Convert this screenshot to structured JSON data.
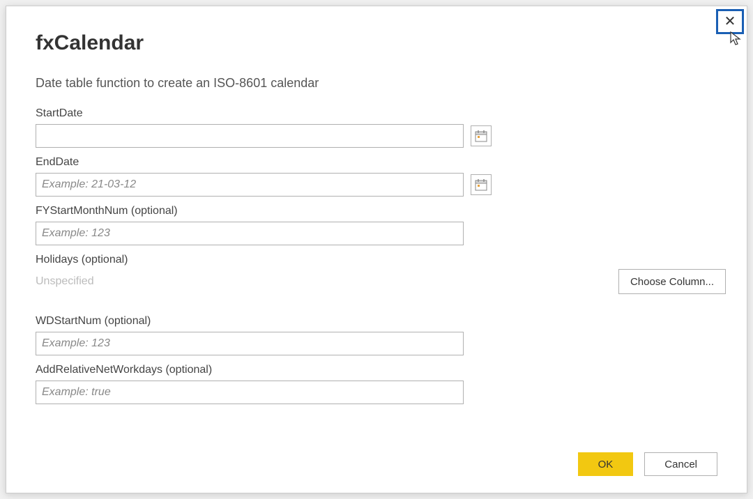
{
  "dialog": {
    "title": "fxCalendar",
    "description": "Date table function to create an ISO-8601 calendar",
    "fields": {
      "startDate": {
        "label": "StartDate",
        "value": "",
        "placeholder": ""
      },
      "endDate": {
        "label": "EndDate",
        "value": "",
        "placeholder": "Example: 21-03-12"
      },
      "fyStartMonthNum": {
        "label": "FYStartMonthNum (optional)",
        "value": "",
        "placeholder": "Example: 123"
      },
      "holidays": {
        "label": "Holidays (optional)",
        "unspecified_text": "Unspecified",
        "choose_column_label": "Choose Column..."
      },
      "wdStartNum": {
        "label": "WDStartNum (optional)",
        "value": "",
        "placeholder": "Example: 123"
      },
      "addRelativeNetWorkdays": {
        "label": "AddRelativeNetWorkdays (optional)",
        "value": "",
        "placeholder": "Example: true"
      }
    },
    "buttons": {
      "ok": "OK",
      "cancel": "Cancel"
    }
  }
}
